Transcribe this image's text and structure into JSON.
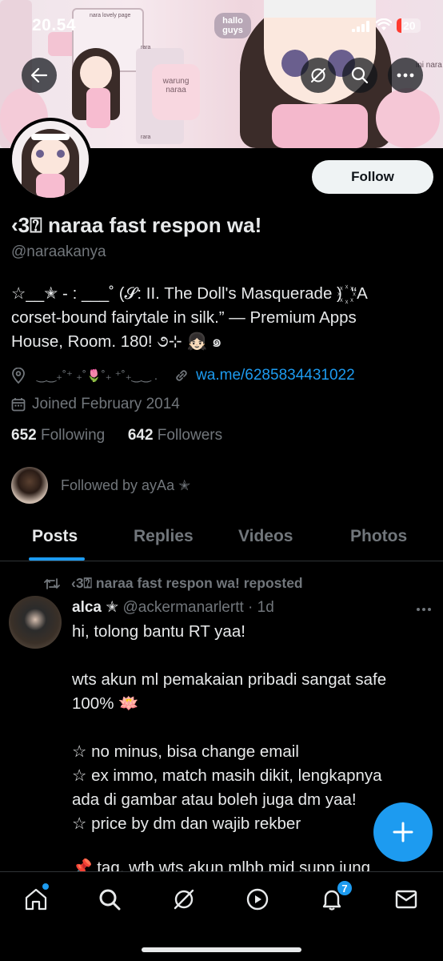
{
  "status_bar": {
    "time": "20.54",
    "battery": "20"
  },
  "banner": {
    "texts": [
      "nara lovely page",
      "hallo guys",
      "warung naraa",
      "rara",
      "rara",
      "rara",
      "ini nara"
    ]
  },
  "profile": {
    "name": "‹3⍰ naraa fast respon wa!",
    "handle": "@naraakanya",
    "follow_label": "Follow",
    "bio_lines": [
      "☆__✭ - : ___˚ (𝓢: II. The Doll's Masquerade ) ꙰ “A",
      "corset-bound fairytale in silk.” — Premium Apps",
      "House, Room. 180! ૭⊹ 👧🏻 ๑"
    ],
    "location": "‿‿₊˚⁺ ₊˚🌷˚₊ ⁺˚₊‿‿ .",
    "link": "wa.me/6285834431022",
    "joined": "Joined February 2014",
    "following_count": "652",
    "following_label": "Following",
    "followers_count": "642",
    "followers_label": "Followers",
    "followed_by": "Followed by ayAa ✭"
  },
  "tabs": [
    {
      "label": "Posts",
      "active": true
    },
    {
      "label": "Replies",
      "active": false
    },
    {
      "label": "Videos",
      "active": false
    },
    {
      "label": "Photos",
      "active": false
    }
  ],
  "post": {
    "repost_text": "‹3⍰ naraa fast respon wa! reposted",
    "author_name": "alca ✭",
    "author_handle": "@ackermanarlertt · 1d",
    "lines": [
      "hi, tolong bantu RT yaa!",
      "",
      "wts akun ml pemakaian pribadi sangat safe",
      "100% 🪷",
      "",
      "☆ no minus, bisa change email",
      "☆ ex immo, match masih dikit, lengkapnya",
      "ada di gambar atau boleh juga dm yaa!",
      "☆ price by dm dan wajib rekber",
      ""
    ],
    "cut_line": "📌 tag, wtb wts akun mlbb mid supp jung"
  },
  "nav": {
    "notifications_badge": "7"
  },
  "colors": {
    "accent": "#1d9bf0",
    "background": "#000000",
    "text": "#e7e9ea",
    "muted": "#71767b"
  }
}
